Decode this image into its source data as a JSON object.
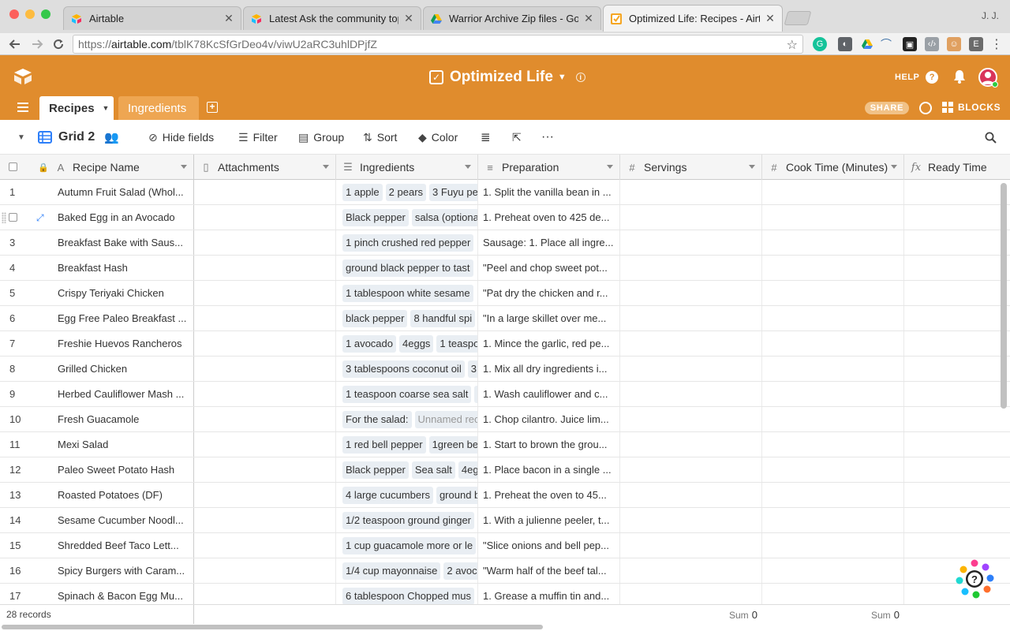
{
  "browser": {
    "tabs": [
      {
        "title": "Airtable",
        "active": false
      },
      {
        "title": "Latest Ask the community topi",
        "active": false
      },
      {
        "title": "Warrior Archive Zip files - Goo",
        "active": false
      },
      {
        "title": "Optimized Life: Recipes - Airta",
        "active": true
      }
    ],
    "profile": "J. J.",
    "url_scheme": "https://",
    "url_host": "airtable.com",
    "url_path": "/tblK78KcSfGrDeo4v/viwU2aRC3uhlDPjfZ"
  },
  "base": {
    "title": "Optimized Life",
    "help_label": "HELP",
    "accent_color": "#e08c2d"
  },
  "tables": {
    "active": "Recipes",
    "other": "Ingredients",
    "share_label": "SHARE",
    "blocks_label": "BLOCKS"
  },
  "viewbar": {
    "view_name": "Grid 2",
    "hide_fields": "Hide fields",
    "filter": "Filter",
    "group": "Group",
    "sort": "Sort",
    "color": "Color"
  },
  "columns": [
    {
      "name": "Recipe Name",
      "type_icon": "text-icon"
    },
    {
      "name": "Attachments",
      "type_icon": "attachment-icon"
    },
    {
      "name": "Ingredients",
      "type_icon": "multiselect-icon"
    },
    {
      "name": "Preparation",
      "type_icon": "longtext-icon"
    },
    {
      "name": "Servings",
      "type_icon": "number-icon"
    },
    {
      "name": "Cook Time (Minutes)",
      "type_icon": "number-icon"
    },
    {
      "name": "Ready Time",
      "type_icon": "formula-icon"
    }
  ],
  "records": [
    {
      "num": "1",
      "name": "Autumn Fruit Salad (Whol...",
      "ingredients": [
        "1 apple",
        "2 pears",
        "3 Fuyu pe"
      ],
      "prep": "1. Split the vanilla bean in ..."
    },
    {
      "num": "",
      "name": "Baked Egg in an Avocado",
      "ingredients": [
        "Black pepper",
        "salsa (optiona"
      ],
      "prep": "1. Preheat oven to 425 de..."
    },
    {
      "num": "3",
      "name": "Breakfast Bake with Saus...",
      "ingredients": [
        "1 pinch crushed red pepper"
      ],
      "prep": "Sausage: 1. Place all ingre..."
    },
    {
      "num": "4",
      "name": "Breakfast Hash",
      "ingredients": [
        "ground black pepper to tast"
      ],
      "prep": "\"Peel and chop sweet pot..."
    },
    {
      "num": "5",
      "name": "Crispy Teriyaki Chicken",
      "ingredients": [
        "1 tablespoon white sesame"
      ],
      "prep": "\"Pat dry the chicken and r..."
    },
    {
      "num": "6",
      "name": "Egg Free Paleo Breakfast ...",
      "ingredients": [
        "black pepper",
        "8 handful spi"
      ],
      "prep": "\"In a large skillet over me..."
    },
    {
      "num": "7",
      "name": "Freshie Huevos Rancheros",
      "ingredients": [
        "1 avocado",
        "4eggs",
        "1 teaspo"
      ],
      "prep": "1. Mince the garlic, red pe..."
    },
    {
      "num": "8",
      "name": "Grilled Chicken",
      "ingredients": [
        "3 tablespoons coconut oil",
        "3"
      ],
      "prep": "1. Mix all dry ingredients i..."
    },
    {
      "num": "9",
      "name": "Herbed Cauliflower Mash ...",
      "ingredients": [
        "1 teaspoon coarse sea salt",
        "1"
      ],
      "prep": "1. Wash cauliflower and c..."
    },
    {
      "num": "10",
      "name": "Fresh Guacamole",
      "ingredients": [
        "For the salad:",
        "Unnamed rec"
      ],
      "muted_index": 1,
      "prep": "1. Chop cilantro. Juice lim..."
    },
    {
      "num": "11",
      "name": "Mexi Salad",
      "ingredients": [
        "1 red bell pepper",
        "1green be"
      ],
      "prep": "1. Start to brown the grou..."
    },
    {
      "num": "12",
      "name": "Paleo Sweet Potato Hash",
      "ingredients": [
        "Black pepper",
        "Sea salt",
        "4eg"
      ],
      "prep": "1. Place bacon in a single ..."
    },
    {
      "num": "13",
      "name": "Roasted Potatoes (DF)",
      "ingredients": [
        "4 large cucumbers",
        "ground b"
      ],
      "prep": "1. Preheat the oven to 45..."
    },
    {
      "num": "14",
      "name": "Sesame Cucumber Noodl...",
      "ingredients": [
        "1/2 teaspoon ground ginger"
      ],
      "prep": "1. With a julienne peeler, t..."
    },
    {
      "num": "15",
      "name": "Shredded Beef Taco Lett...",
      "ingredients": [
        "1 cup guacamole more or le"
      ],
      "prep": "\"Slice onions and bell pep..."
    },
    {
      "num": "16",
      "name": "Spicy Burgers with Caram...",
      "ingredients": [
        "1/4 cup mayonnaise",
        "2 avoc"
      ],
      "prep": "\"Warm half of the beef tal..."
    },
    {
      "num": "17",
      "name": "Spinach & Bacon Egg Mu...",
      "ingredients": [
        "6 tablespoon Chopped mus"
      ],
      "prep": "1. Grease a muffin tin and..."
    }
  ],
  "footer": {
    "record_count": "28 records",
    "sum_label": "Sum",
    "sum_cook": "0",
    "sum_ready": "0"
  }
}
